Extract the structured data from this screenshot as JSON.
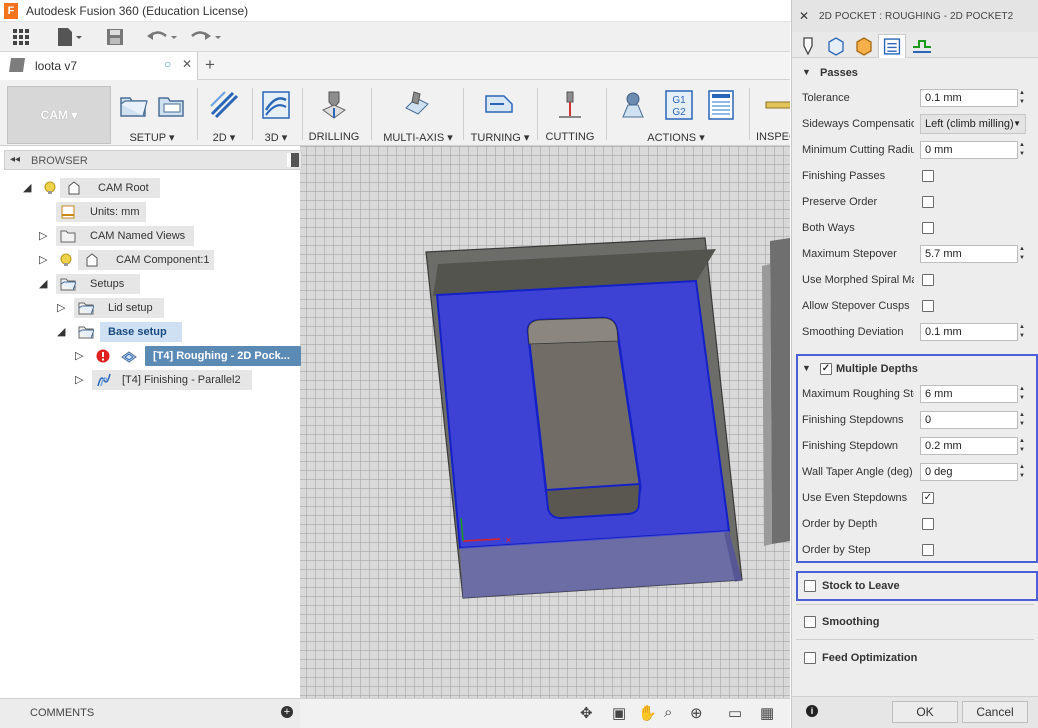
{
  "window": {
    "title": "Autodesk Fusion 360 (Education License)",
    "logo": "F"
  },
  "document": {
    "tab_name": "loota v7"
  },
  "ribbon": {
    "workspace": "CAM",
    "groups": [
      {
        "label": "SETUP"
      },
      {
        "label": "2D"
      },
      {
        "label": "3D"
      },
      {
        "label": "DRILLING"
      },
      {
        "label": "MULTI-AXIS"
      },
      {
        "label": "TURNING"
      },
      {
        "label": "CUTTING"
      },
      {
        "label": "ACTIONS"
      },
      {
        "label": "INSPEC"
      }
    ],
    "g1g2": {
      "top": "G1",
      "bottom": "G2"
    }
  },
  "browser": {
    "title": "BROWSER",
    "nodes": {
      "cam_root": "CAM Root",
      "units": "Units: mm",
      "named_views": "CAM Named Views",
      "component": "CAM Component:1",
      "setups": "Setups",
      "lid_setup": "Lid setup",
      "base_setup": "Base setup",
      "roughing": "[T4] Roughing - 2D Pock...",
      "finishing": "[T4] Finishing - Parallel2"
    }
  },
  "comments": {
    "label": "COMMENTS"
  },
  "panel": {
    "title": "2D POCKET : ROUGHING - 2D POCKET2",
    "passes": {
      "header": "Passes",
      "tolerance": {
        "label": "Tolerance",
        "value": "0.1 mm"
      },
      "sideways": {
        "label": "Sideways Compensation",
        "value": "Left (climb milling)"
      },
      "min_radius": {
        "label": "Minimum Cutting Radius",
        "value": "0 mm"
      },
      "finishing_passes": {
        "label": "Finishing Passes",
        "checked": false
      },
      "preserve_order": {
        "label": "Preserve Order",
        "checked": false
      },
      "both_ways": {
        "label": "Both Ways",
        "checked": false
      },
      "max_stepover": {
        "label": "Maximum Stepover",
        "value": "5.7 mm"
      },
      "morphed_spiral": {
        "label": "Use Morphed Spiral Machining",
        "checked": false
      },
      "allow_cusps": {
        "label": "Allow Stepover Cusps",
        "checked": false
      },
      "smoothing_dev": {
        "label": "Smoothing Deviation",
        "value": "0.1 mm"
      }
    },
    "multiple_depths": {
      "header": "Multiple Depths",
      "checked": true,
      "max_roughing": {
        "label": "Maximum Roughing Stepdown",
        "value": "6 mm"
      },
      "finishing_stepdowns": {
        "label": "Finishing Stepdowns",
        "value": "0"
      },
      "finishing_stepdown": {
        "label": "Finishing Stepdown",
        "value": "0.2 mm"
      },
      "wall_taper": {
        "label": "Wall Taper Angle (deg)",
        "value": "0 deg"
      },
      "even_stepdowns": {
        "label": "Use Even Stepdowns",
        "checked": true
      },
      "order_depth": {
        "label": "Order by Depth",
        "checked": false
      },
      "order_step": {
        "label": "Order by Step",
        "checked": false
      }
    },
    "stock_to_leave": {
      "header": "Stock to Leave",
      "checked": false
    },
    "smoothing": {
      "header": "Smoothing",
      "checked": false
    },
    "feed_opt": {
      "header": "Feed Optimization",
      "checked": false
    },
    "ok_label": "OK",
    "cancel_label": "Cancel"
  },
  "colors": {
    "selection": "#4b5fd6",
    "toolpath_fill": "#3a3ee0",
    "tree_selected": "#5b8ab5"
  }
}
